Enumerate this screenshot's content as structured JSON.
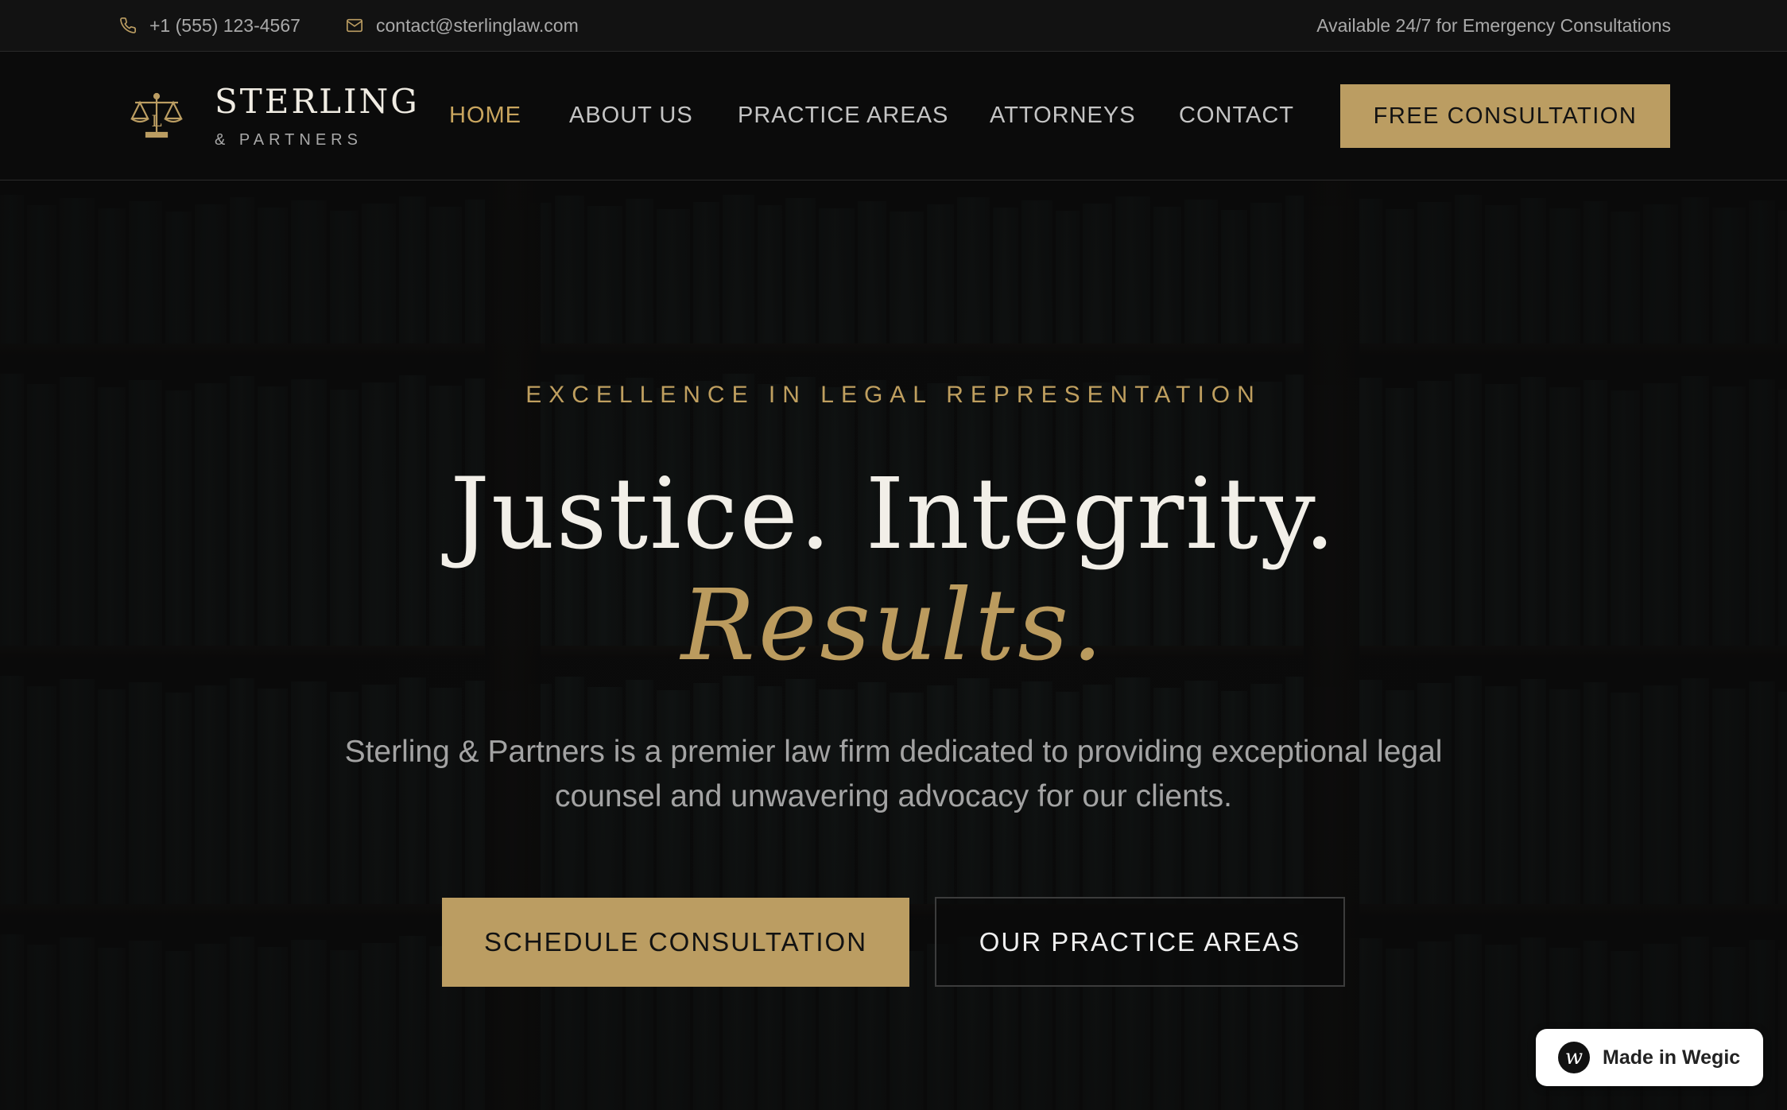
{
  "topbar": {
    "phone": "+1 (555) 123-4567",
    "email": "contact@sterlinglaw.com",
    "availability": "Available 24/7 for Emergency Consultations"
  },
  "brand": {
    "name": "STERLING",
    "subtitle": "& PARTNERS"
  },
  "nav": {
    "items": [
      {
        "label": "HOME",
        "active": true
      },
      {
        "label": "ABOUT US"
      },
      {
        "label": "PRACTICE AREAS"
      },
      {
        "label": "ATTORNEYS"
      },
      {
        "label": "CONTACT"
      }
    ],
    "cta": "FREE CONSULTATION"
  },
  "hero": {
    "eyebrow": "EXCELLENCE IN LEGAL REPRESENTATION",
    "headline": "Justice. Integrity.",
    "headline_accent": "Results.",
    "lead": "Sterling & Partners is a premier law firm dedicated to providing exceptional legal counsel and unwavering advocacy for our clients.",
    "primary_button": "SCHEDULE CONSULTATION",
    "secondary_button": "OUR PRACTICE AREAS"
  },
  "badge": {
    "label": "Made in Wegic"
  },
  "colors": {
    "accent": "#bb9d62",
    "background": "#0d0d0d",
    "text_light": "#f2efe8",
    "text_muted": "#a3a3a3"
  },
  "icons": [
    "phone-icon",
    "mail-icon",
    "scales-of-justice-icon",
    "wegic-logo-icon"
  ]
}
